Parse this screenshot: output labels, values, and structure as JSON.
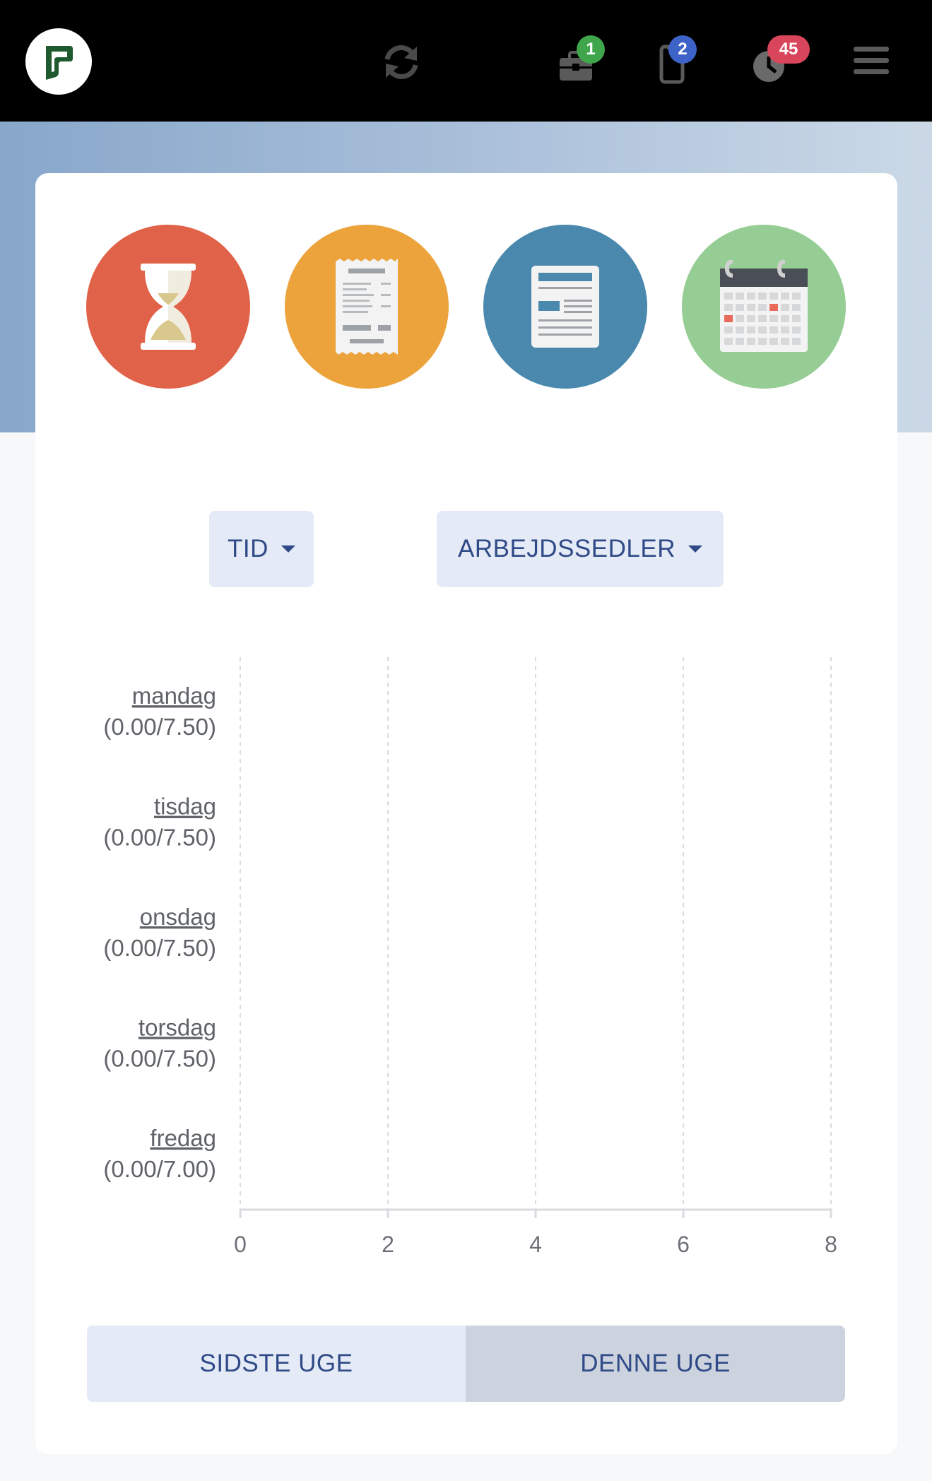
{
  "header": {
    "icons": [
      "logo-icon",
      "refresh-icon",
      "briefcase-icon",
      "phone-icon",
      "clock-icon",
      "menu-icon"
    ],
    "badges": {
      "briefcase": "1",
      "phone": "2",
      "clock": "45"
    },
    "colors": {
      "briefcase_badge": "#3fa64b",
      "phone_badge": "#3d63c9",
      "clock_badge": "#d9455a"
    }
  },
  "tiles": [
    {
      "icon": "hourglass-icon",
      "color": "#e06248"
    },
    {
      "icon": "receipt-icon",
      "color": "#eca33c"
    },
    {
      "icon": "document-icon",
      "color": "#4a89ad"
    },
    {
      "icon": "calendar-icon",
      "color": "#95cd95"
    }
  ],
  "filters": {
    "tid": "TID",
    "arbejdssedler": "ARBEJDSSEDLER"
  },
  "chart_data": {
    "type": "bar",
    "orientation": "horizontal",
    "categories": [
      "mandag",
      "tisdag",
      "onsdag",
      "torsdag",
      "fredag"
    ],
    "category_details": [
      "(0.00/7.50)",
      "(0.00/7.50)",
      "(0.00/7.50)",
      "(0.00/7.50)",
      "(0.00/7.00)"
    ],
    "values": [
      0,
      0,
      0,
      0,
      0
    ],
    "xlim": [
      0,
      8
    ],
    "xticks": [
      "0",
      "2",
      "4",
      "6",
      "8"
    ],
    "grid": true
  },
  "period": {
    "last_week": "SIDSTE UGE",
    "this_week": "DENNE UGE",
    "selected": "DENNE UGE"
  }
}
